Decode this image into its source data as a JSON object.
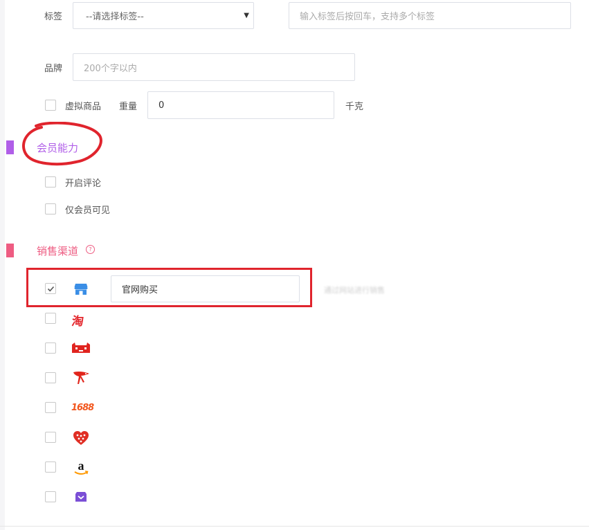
{
  "tags": {
    "label": "标签",
    "select_value": "--请选择标签--",
    "input_placeholder": "输入标签后按回车，支持多个标签"
  },
  "brand": {
    "label": "品牌",
    "placeholder": "200个字以内"
  },
  "virtual_goods": {
    "label": "虚拟商品",
    "checked": false
  },
  "weight": {
    "label": "重量",
    "value": "0",
    "unit": "千克"
  },
  "member_section": {
    "title": "会员能力",
    "accent": "#b05ee8",
    "options": [
      {
        "label": "开启评论",
        "checked": false
      },
      {
        "label": "仅会员可见",
        "checked": false
      }
    ]
  },
  "sales_section": {
    "title": "销售渠道",
    "accent": "#ee5c82",
    "help_icon": "question-circle-icon",
    "channels": [
      {
        "icon": "store-icon",
        "checked": true,
        "name_value": "官网购买",
        "hint": "通过网站进行销售"
      },
      {
        "icon": "taobao-icon",
        "checked": false
      },
      {
        "icon": "tmall-icon",
        "checked": false
      },
      {
        "icon": "jd-icon",
        "checked": false
      },
      {
        "icon": "1688-icon",
        "checked": false
      },
      {
        "icon": "pinduoduo-icon",
        "checked": false
      },
      {
        "icon": "amazon-icon",
        "checked": false
      },
      {
        "icon": "shop-bag-icon",
        "checked": false
      }
    ]
  },
  "annotation_colors": {
    "red_marker": "#e0242d"
  }
}
